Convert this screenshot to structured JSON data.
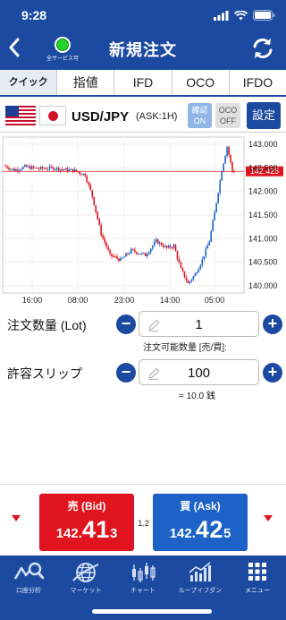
{
  "status_bar": {
    "time": "9:28"
  },
  "nav": {
    "title": "新規注文",
    "service_status": "全サービス可"
  },
  "tabs": [
    {
      "label": "クイック",
      "active": true
    },
    {
      "label": "指値"
    },
    {
      "label": "IFD"
    },
    {
      "label": "OCO"
    },
    {
      "label": "IFDO"
    }
  ],
  "pair": {
    "name": "USD/JPY",
    "ask_info": "(ASK:1H)",
    "confirm_label_1": "確認",
    "confirm_label_2": "ON",
    "oco_label_1": "OCO",
    "oco_label_2": "OFF",
    "settings_label": "設定"
  },
  "chart_data": {
    "type": "candlestick",
    "x_ticks": [
      "16:00",
      "08:00",
      "23:00",
      "14:00",
      "05:00"
    ],
    "y_ticks": [
      "143.000",
      "142.500",
      "142.000",
      "141.500",
      "141.000",
      "140.500",
      "140.000"
    ],
    "ylim": [
      139.85,
      143.15
    ],
    "current_price_label": "142.425",
    "current_price": 142.425,
    "colors": {
      "up": "#1c62c7",
      "down": "#e0141e",
      "line": "#e0141e"
    }
  },
  "order": {
    "qty_label": "注文数量 (Lot)",
    "qty_value": "1",
    "qty_sub": "注文可能数量 [売/買]:",
    "slip_label": "許容スリップ",
    "slip_value": "100",
    "slip_sub": "= 10.0 銭"
  },
  "quote": {
    "bid_label": "売 (Bid)",
    "bid_p1": "142.",
    "bid_p2": "41",
    "bid_p3": "3",
    "ask_label": "買 (Ask)",
    "ask_p1": "142.",
    "ask_p2": "42",
    "ask_p3": "5",
    "spread": "1.2"
  },
  "bottom_nav": [
    {
      "label": "口座分析",
      "icon": "account-analysis-icon"
    },
    {
      "label": "マーケット",
      "icon": "market-globe-icon"
    },
    {
      "label": "チャート",
      "icon": "chart-candle-icon"
    },
    {
      "label": "ループイフダン",
      "icon": "loop-ifdone-icon"
    },
    {
      "label": "メニュー",
      "icon": "menu-grid-icon"
    }
  ]
}
